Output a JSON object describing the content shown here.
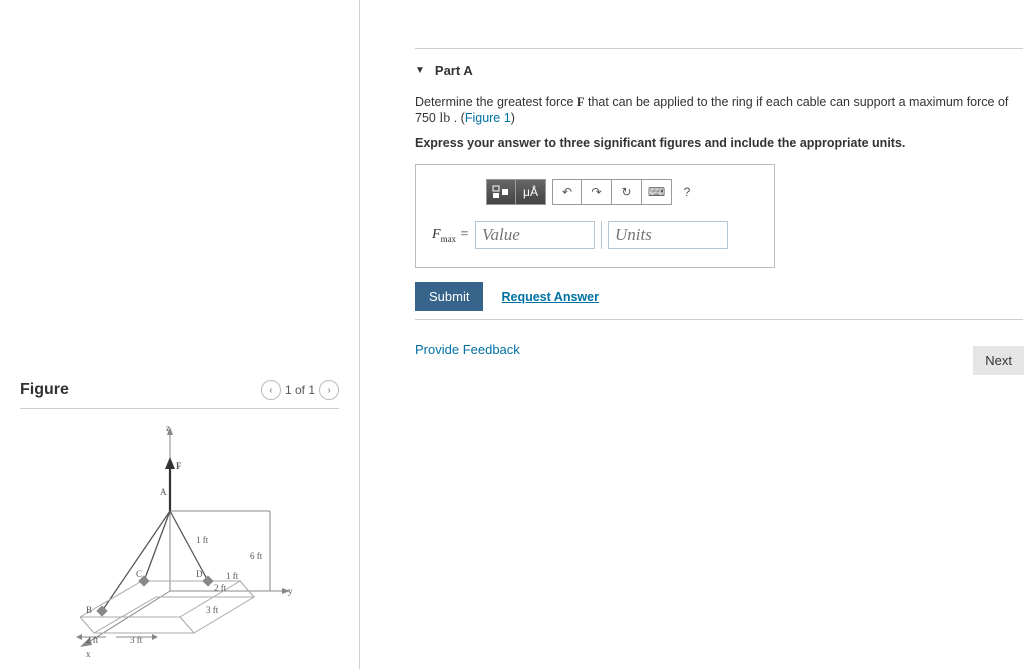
{
  "figure": {
    "title": "Figure",
    "nav_prev": "‹",
    "nav_text": "1 of 1",
    "nav_next": "›",
    "labels": {
      "z": "z",
      "F": "F",
      "A": "A",
      "B": "B",
      "C": "C",
      "D": "D",
      "x": "x",
      "y": "y",
      "d1": "1 ft",
      "d6": "6 ft",
      "d1b": "1 ft",
      "d2ft": "2 ft",
      "d3ft": "3 ft",
      "d2l": "2 ft",
      "d3l": "3 ft"
    }
  },
  "partA": {
    "title": "Part A",
    "question_prefix": "Determine the greatest force ",
    "question_var": "F",
    "question_mid": " that can be applied to the ring if each cable can support a maximum force of 750 ",
    "question_unit": "lb",
    "question_end": " . (",
    "figure_link": "Figure 1",
    "question_close": ")",
    "instruction": "Express your answer to three significant figures and include the appropriate units.",
    "toolbar": {
      "templates": "⬚",
      "special": "μÅ",
      "undo": "↶",
      "redo": "↷",
      "reset": "↻",
      "keyboard": "⌨",
      "help": "?"
    },
    "var_label": "F",
    "var_sub": "max",
    "equals": " = ",
    "value_placeholder": "Value",
    "units_placeholder": "Units",
    "submit": "Submit",
    "request_answer": "Request Answer"
  },
  "footer": {
    "provide_feedback": "Provide Feedback",
    "next": "Next"
  }
}
